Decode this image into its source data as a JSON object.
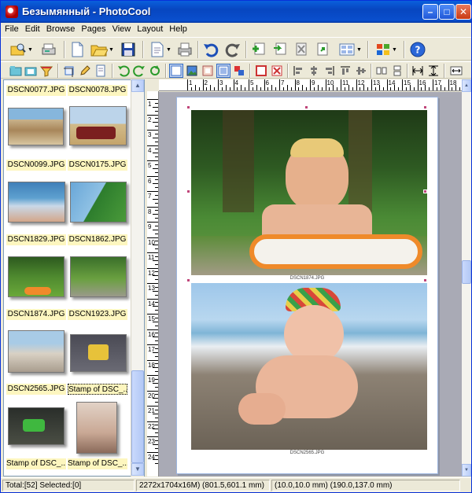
{
  "window": {
    "title": "Безымянный - PhotoCool"
  },
  "menu": [
    {
      "label": "File"
    },
    {
      "label": "Edit"
    },
    {
      "label": "Browse"
    },
    {
      "label": "Pages"
    },
    {
      "label": "View"
    },
    {
      "label": "Layout"
    },
    {
      "label": "Help"
    }
  ],
  "thumbnails": [
    {
      "name": "DSCN0077.JPG"
    },
    {
      "name": "DSCN0078.JPG"
    },
    {
      "name": "DSCN0099.JPG"
    },
    {
      "name": "DSCN0175.JPG"
    },
    {
      "name": "DSCN1829.JPG"
    },
    {
      "name": "DSCN1862.JPG"
    },
    {
      "name": "DSCN1874.JPG"
    },
    {
      "name": "DSCN1923.JPG"
    },
    {
      "name": "DSCN2565.JPG"
    },
    {
      "name": "Stamp of DSC_..."
    },
    {
      "name": "Stamp of DSC_..."
    },
    {
      "name": "Stamp of DSC_..."
    }
  ],
  "ruler": {
    "top_labels": [
      "1",
      "2",
      "3",
      "4",
      "5",
      "6",
      "7",
      "8",
      "9",
      "10",
      "11",
      "12",
      "13",
      "14",
      "15",
      "16",
      "17",
      "18",
      "19"
    ],
    "left_labels": [
      "1",
      "2",
      "3",
      "4",
      "5",
      "6",
      "7",
      "8",
      "9",
      "10",
      "11",
      "12",
      "13",
      "14",
      "15",
      "16",
      "17",
      "18",
      "19",
      "20",
      "21",
      "22",
      "23",
      "24"
    ]
  },
  "status": {
    "total": "Total:[52] Selected:[0]",
    "image_info": "2272x1704x16M) (801.5,601.1 mm)",
    "coords": "(10.0,10.0 mm) (190.0,137.0 mm)"
  },
  "page": {
    "caption1": "DSCN1874.JPG",
    "caption2": "DSCN2565.JPG"
  },
  "colors": {
    "titlebar": "#0a4fce",
    "caption_bg": "#fdf6bf",
    "workspace": "#a9aab5"
  }
}
